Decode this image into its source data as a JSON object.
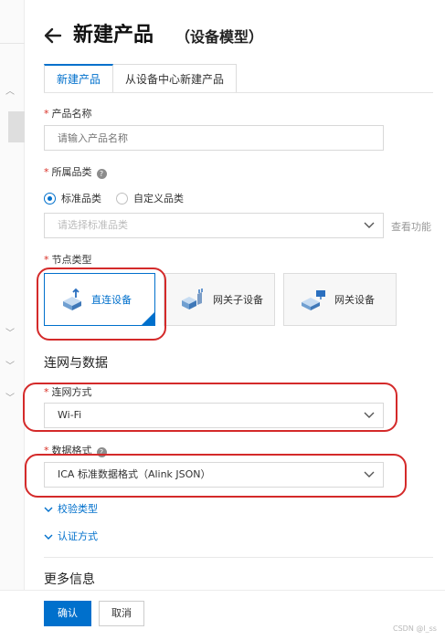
{
  "header": {
    "title": "新建产品",
    "subtitle": "（设备模型）"
  },
  "tabs": [
    {
      "label": "新建产品",
      "active": true
    },
    {
      "label": "从设备中心新建产品",
      "active": false
    }
  ],
  "form": {
    "product_name": {
      "label": "产品名称",
      "placeholder": "请输入产品名称"
    },
    "category": {
      "label": "所属品类",
      "options": [
        {
          "label": "标准品类",
          "checked": true
        },
        {
          "label": "自定义品类",
          "checked": false
        }
      ],
      "placeholder": "请选择标准品类",
      "side_link": "查看功能"
    },
    "node_type": {
      "label": "节点类型",
      "cards": [
        {
          "label": "直连设备",
          "selected": true
        },
        {
          "label": "网关子设备",
          "selected": false
        },
        {
          "label": "网关设备",
          "selected": false
        }
      ]
    },
    "network_section": "连网与数据",
    "network_method": {
      "label": "连网方式",
      "value": "Wi-Fi"
    },
    "data_format": {
      "label": "数据格式",
      "value": "ICA 标准数据格式（Alink JSON）"
    },
    "verify_type": "校验类型",
    "auth_method": "认证方式",
    "more_info": "更多信息"
  },
  "footer": {
    "confirm": "确认",
    "cancel": "取消"
  },
  "watermark": "CSDN @l_ss",
  "colors": {
    "accent": "#0070cc",
    "annotation": "#d42a2a",
    "required": "#d93026"
  }
}
